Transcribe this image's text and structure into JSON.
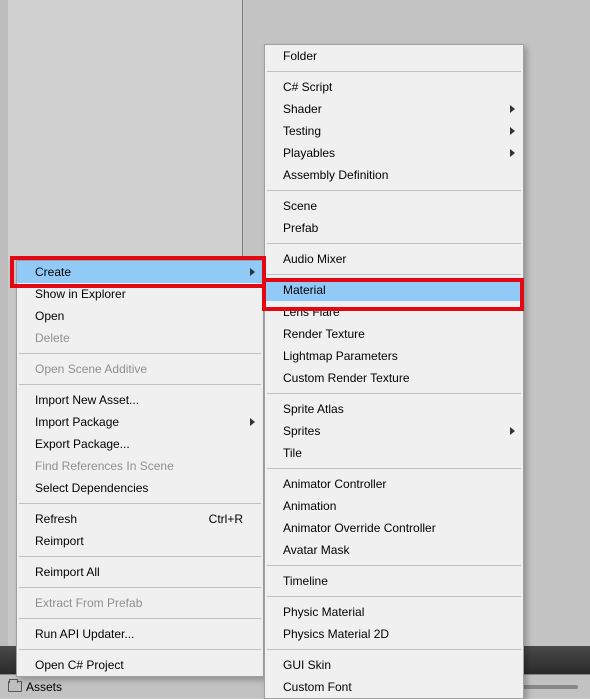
{
  "bottom": {
    "assets_label": "Assets"
  },
  "left_menu": {
    "create": "Create",
    "show_in_explorer": "Show in Explorer",
    "open": "Open",
    "delete": "Delete",
    "open_scene_additive": "Open Scene Additive",
    "import_new_asset": "Import New Asset...",
    "import_package": "Import Package",
    "export_package": "Export Package...",
    "find_references": "Find References In Scene",
    "select_dependencies": "Select Dependencies",
    "refresh": "Refresh",
    "refresh_shortcut": "Ctrl+R",
    "reimport": "Reimport",
    "reimport_all": "Reimport All",
    "extract_from_prefab": "Extract From Prefab",
    "run_api_updater": "Run API Updater...",
    "open_cs_project": "Open C# Project"
  },
  "right_menu": {
    "folder": "Folder",
    "cs_script": "C# Script",
    "shader": "Shader",
    "testing": "Testing",
    "playables": "Playables",
    "assembly_definition": "Assembly Definition",
    "scene": "Scene",
    "prefab": "Prefab",
    "audio_mixer": "Audio Mixer",
    "material": "Material",
    "lens_flare": "Lens Flare",
    "render_texture": "Render Texture",
    "lightmap_parameters": "Lightmap Parameters",
    "custom_render_texture": "Custom Render Texture",
    "sprite_atlas": "Sprite Atlas",
    "sprites": "Sprites",
    "tile": "Tile",
    "animator_controller": "Animator Controller",
    "animation": "Animation",
    "animator_override_controller": "Animator Override Controller",
    "avatar_mask": "Avatar Mask",
    "timeline": "Timeline",
    "physic_material": "Physic Material",
    "physics_material_2d": "Physics Material 2D",
    "gui_skin": "GUI Skin",
    "custom_font": "Custom Font"
  }
}
